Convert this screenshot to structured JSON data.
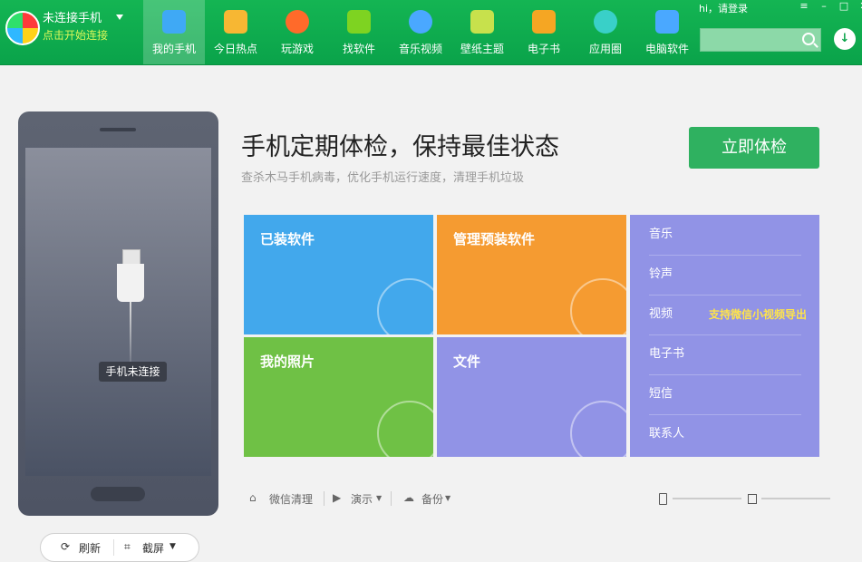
{
  "header": {
    "device_status": "未连接手机",
    "connect_link": "点击开始连接",
    "nav": [
      {
        "label": "我的手机",
        "icon": "phone-icon",
        "color": "#3fa9f5",
        "active": true
      },
      {
        "label": "今日热点",
        "icon": "star-icon",
        "color": "#f7b733",
        "active": false
      },
      {
        "label": "玩游戏",
        "icon": "gamepad-icon",
        "color": "#ff6a2a",
        "active": false
      },
      {
        "label": "找软件",
        "icon": "android-icon",
        "color": "#7ed321",
        "active": false
      },
      {
        "label": "音乐视频",
        "icon": "play-icon",
        "color": "#4aa8ff",
        "active": false
      },
      {
        "label": "壁纸主题",
        "icon": "wallpaper-icon",
        "color": "#c7e14c",
        "active": false
      },
      {
        "label": "电子书",
        "icon": "book-icon",
        "color": "#f5a623",
        "active": false
      },
      {
        "label": "应用圈",
        "icon": "circle-icon",
        "color": "#39d0c8",
        "active": false
      },
      {
        "label": "电脑软件",
        "icon": "monitor-icon",
        "color": "#4aa8ff",
        "active": false
      }
    ],
    "greeting": "hi，请登录",
    "search_placeholder": ""
  },
  "phone": {
    "status": "手机未连接",
    "refresh": "刷新",
    "screenshot": "截屏"
  },
  "main": {
    "headline": "手机定期体检，保持最佳状态",
    "subline": "查杀木马手机病毒，优化手机运行速度，清理手机垃圾",
    "check_button": "立即体检",
    "tiles": {
      "installed": "已装软件",
      "preinstalled": "管理预装软件",
      "photos": "我的照片",
      "files": "文件"
    },
    "media_list": [
      "音乐",
      "铃声",
      "视频",
      "电子书",
      "短信",
      "联系人"
    ],
    "video_hint": "支持微信小视频导出"
  },
  "toolbar": {
    "wechat_clean": "微信清理",
    "demo": "演示",
    "backup": "备份"
  }
}
